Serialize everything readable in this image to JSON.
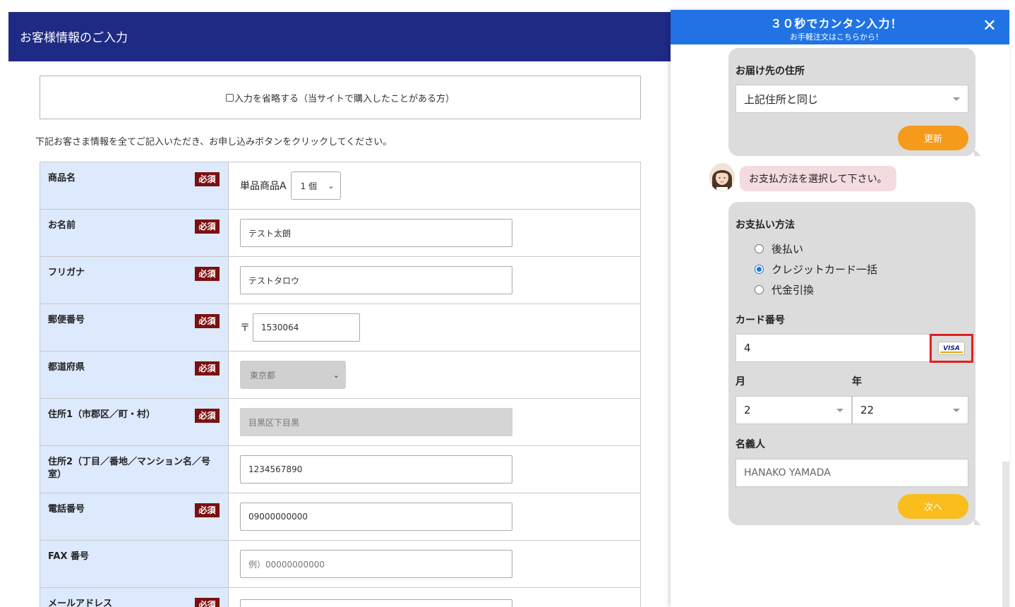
{
  "form": {
    "header_title": "お客様情報のご入力",
    "skip_label": "入力を省略する（当サイトで購入したことがある方）",
    "instructions": "下記お客さま情報を全てご記入いただき、お申し込みボタンをクリックしてください。",
    "required_badge": "必須",
    "rows": [
      {
        "label": "商品名",
        "product": "単品商品A",
        "quantity": "1 個"
      },
      {
        "label": "お名前",
        "value": "テスト太朗"
      },
      {
        "label": "フリガナ",
        "value": "テストタロウ"
      },
      {
        "label": "郵便番号",
        "prefix": "〒",
        "value": "1530064"
      },
      {
        "label": "都道府県",
        "value": "東京都"
      },
      {
        "label": "住所1（市郡区／町・村）",
        "value": "目黒区下目黒"
      },
      {
        "label": "住所2（丁目／番地／マンション名／号室）",
        "value": "1234567890"
      },
      {
        "label": "電話番号",
        "value": "09000000000"
      },
      {
        "label": "FAX 番号",
        "placeholder": "例）00000000000"
      },
      {
        "label": "メールアドレス",
        "value": ""
      }
    ]
  },
  "chat": {
    "header_title": "３０秒でカンタン入力！",
    "header_subtitle": "お手軽注文はこちらから！",
    "close_glyph": "✕",
    "delivery": {
      "label": "お届け先の住所",
      "selected": "上記住所と同じ",
      "update_button": "更新"
    },
    "operator_message": "お支払方法を選択して下さい。",
    "payment": {
      "label": "お支払い方法",
      "options": [
        "後払い",
        "クレジットカード一括",
        "代金引換"
      ],
      "selected_index": 1,
      "card_number_label": "カード番号",
      "card_number_value": "4",
      "card_brand": "VISA",
      "month_label": "月",
      "month_value": "2",
      "year_label": "年",
      "year_value": "22",
      "holder_label": "名義人",
      "holder_placeholder": "HANAKO YAMADA",
      "next_button": "次へ"
    },
    "colors": {
      "header": "#2173e4",
      "update_button": "#f59a1b",
      "next_button": "#f9bd1d",
      "highlight": "#e02020"
    }
  }
}
